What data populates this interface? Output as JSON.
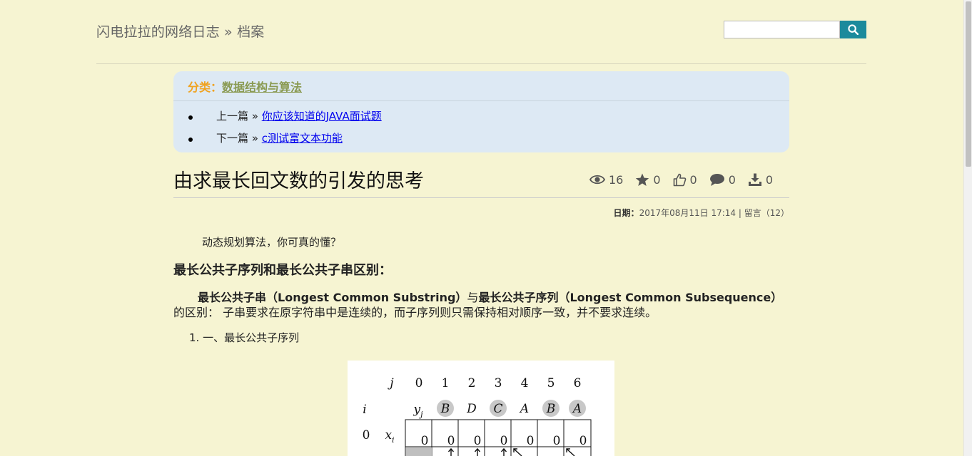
{
  "header": {
    "site_title": "闪电拉拉的网络日志 » 档案",
    "search_placeholder": ""
  },
  "nav": {
    "category_label": "分类：",
    "category_link": "数据结构与算法",
    "prev_label": "上一篇 » ",
    "prev_link": "你应该知道的JAVA面试题",
    "next_label": "下一篇 » ",
    "next_link": "c测试富文本功能"
  },
  "post": {
    "title": "由求最长回文数的引发的思考",
    "stats": {
      "views": "16",
      "stars": "0",
      "likes": "0",
      "comments": "0",
      "downloads": "0"
    },
    "meta_date_label": "日期：",
    "meta_date": "2017年08月11日 17:14",
    "meta_sep": " | ",
    "meta_comments": "留言（12）"
  },
  "content": {
    "intro": "动态规划算法，你可真的懂？",
    "heading": "最长公共子序列和最长公共子串区别：",
    "para_bold1": "最长公共子串（Longest Common Substring）",
    "para_mid": "与",
    "para_bold2": "最长公共子序列（Longest Common Subsequence）",
    "para_rest": "的区别： 子串要求在原字符串中是连续的，而子序列则只需保持相对顺序一致，并不要求连续。",
    "list_num": "1.",
    "list_item": "一、最长公共子序列"
  },
  "figure": {
    "j_label": "j",
    "i_label": "i",
    "y_label": "y",
    "y_sub": "j",
    "x_label": "x",
    "x_sub": "i",
    "row0": "0",
    "j_values": [
      "0",
      "1",
      "2",
      "3",
      "4",
      "5",
      "6"
    ],
    "y_values": [
      "B",
      "D",
      "C",
      "A",
      "B",
      "A"
    ],
    "circled": [
      true,
      false,
      true,
      false,
      true,
      true
    ],
    "row0_values": [
      "0",
      "0",
      "0",
      "0",
      "0",
      "0",
      "0"
    ]
  },
  "colors": {
    "background": "#f6f4d2",
    "accent": "#1b8a9c",
    "category_label": "#f0a21f",
    "category_link": "#8a9a52",
    "nav_box": "#dde9f4"
  }
}
